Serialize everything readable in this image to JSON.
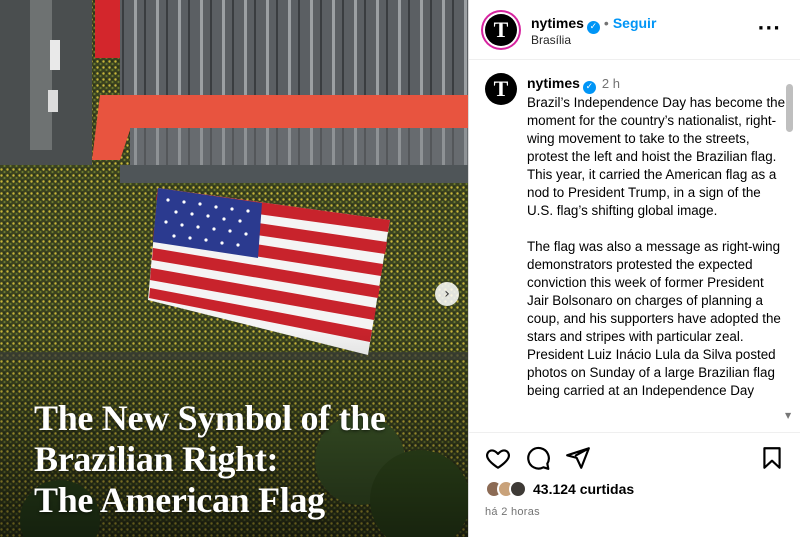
{
  "post_image": {
    "headline_lines": [
      "The New Symbol of the",
      "Brazilian Right:",
      "The American Flag"
    ],
    "carousel_next_icon": "chevron-right-icon"
  },
  "header": {
    "avatar_letter": "T",
    "username": "nytimes",
    "separator": "•",
    "follow_label": "Seguir",
    "location": "Brasília",
    "more_icon": "ellipsis-icon"
  },
  "caption": {
    "avatar_letter": "T",
    "username": "nytimes",
    "time": "2 h",
    "paragraphs": [
      "Brazil’s Independence Day has become the moment for the country’s nationalist, right-wing movement to take to the streets, protest the left and hoist the Brazilian flag. This year, it carried the American flag as a nod to President Trump, in a sign of the U.S. flag’s shifting global image.",
      "The flag was also a message as right-wing demonstrators protested the expected conviction this week of former President Jair Bolsonaro on charges of planning a coup, and his supporters have adopted the stars and stripes with particular zeal. President Luiz Inácio Lula da Silva posted photos on Sunday of a large Brazilian flag being carried at an Independence Day"
    ]
  },
  "actions": {
    "like_icon": "heart-icon",
    "comment_icon": "comment-icon",
    "share_icon": "send-icon",
    "save_icon": "bookmark-icon",
    "likes_text": "43.124 curtidas",
    "time_ago": "há 2 horas"
  },
  "colors": {
    "verified": "#0095f6",
    "follow": "#0095f6",
    "muted": "#737373"
  }
}
